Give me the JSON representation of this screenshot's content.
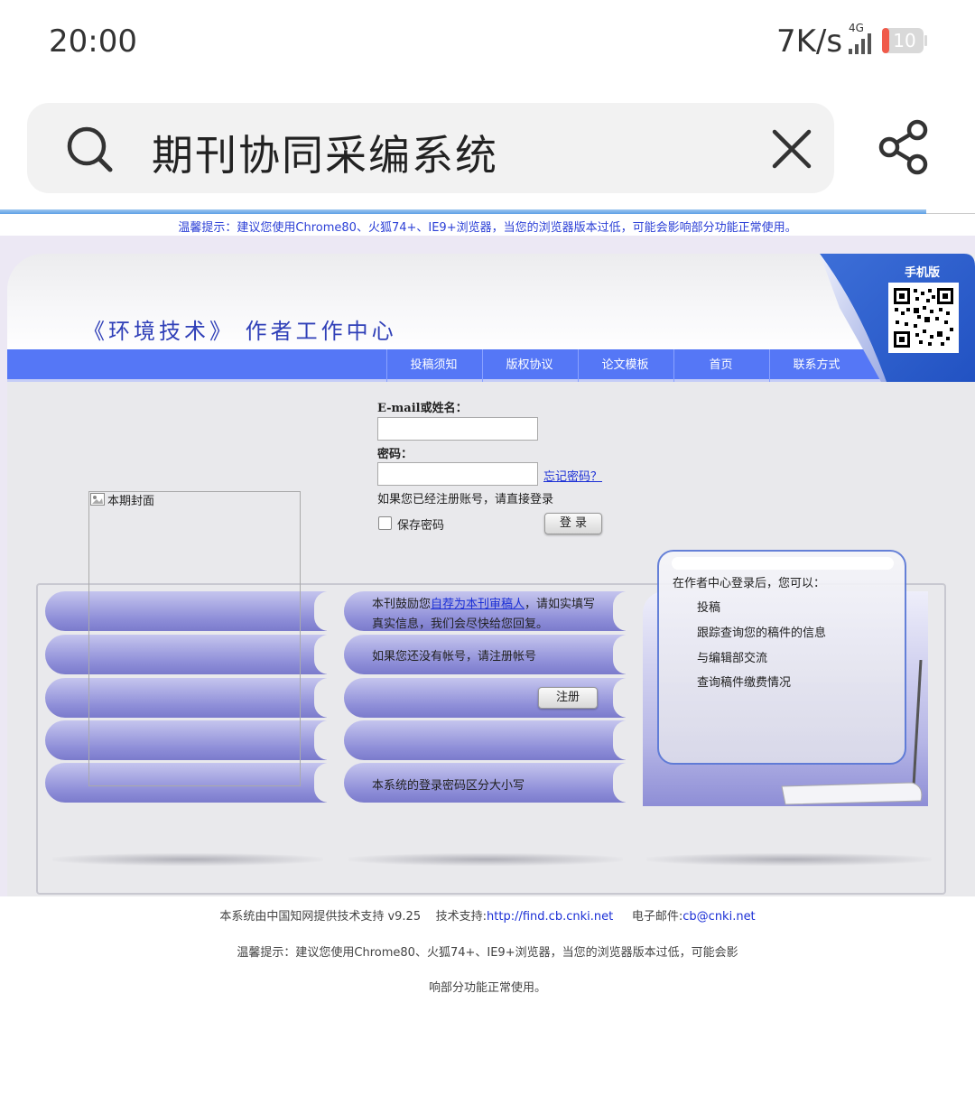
{
  "status_bar": {
    "time": "20:00",
    "net_speed": "7K/s",
    "network_type": "4G",
    "battery": "10",
    "icons": [
      "signal-icon",
      "battery-icon"
    ]
  },
  "search": {
    "query": "期刊协同采编系统",
    "icons": [
      "search-icon",
      "close-icon",
      "share-icon"
    ]
  },
  "page_load_progress": 0.95,
  "top_tip": "温馨提示：建议您使用Chrome80、火狐74+、IE9+浏览器，当您的浏览器版本过低，可能会影响部分功能正常使用。",
  "header": {
    "title": "《环境技术》 作者工作中心",
    "mobile_label": "手机版"
  },
  "nav": {
    "items": [
      "投稿须知",
      "版权协议",
      "论文模板",
      "首页",
      "联系方式"
    ]
  },
  "login": {
    "email_label": "E-mail或姓名：",
    "password_label": "密码：",
    "forgot_link": "忘记密码？",
    "registered_hint": "如果您已经注册账号，请直接登录",
    "save_password_label": "保存密码",
    "login_button": "登 录"
  },
  "cover": {
    "label": "本期封面"
  },
  "reviewer": {
    "text_before": "本刊鼓励您",
    "link": "自荐为本刊审稿人",
    "text_after": "，请如实填写",
    "line2": "真实信息，我们会尽快给您回复。"
  },
  "register": {
    "hint": "如果您还没有帐号，请注册帐号",
    "button": "注册"
  },
  "case_note": "本系统的登录密码区分大小写",
  "author_center": {
    "heading": "在作者中心登录后，您可以：",
    "items": [
      "投稿",
      "跟踪查询您的稿件的信息",
      "与编辑部交流",
      "查询稿件缴费情况"
    ]
  },
  "footer": {
    "support_text": "本系统由中国知网提供技术支持 v9.25",
    "tech_label": "技术支持:",
    "tech_link": "http://find.cb.cnki.net",
    "email_label": "电子邮件:",
    "email_link": "cb@cnki.net",
    "tip_line1": "温馨提示：建议您使用Chrome80、火狐74+、IE9+浏览器，当您的浏览器版本过低，可能会影",
    "tip_line2": "响部分功能正常使用。"
  },
  "colors": {
    "nav_blue": "#5577f6",
    "link_blue": "#1b2fd6",
    "panel_border": "#5a78d6",
    "battery_low": "#f05a4a"
  }
}
